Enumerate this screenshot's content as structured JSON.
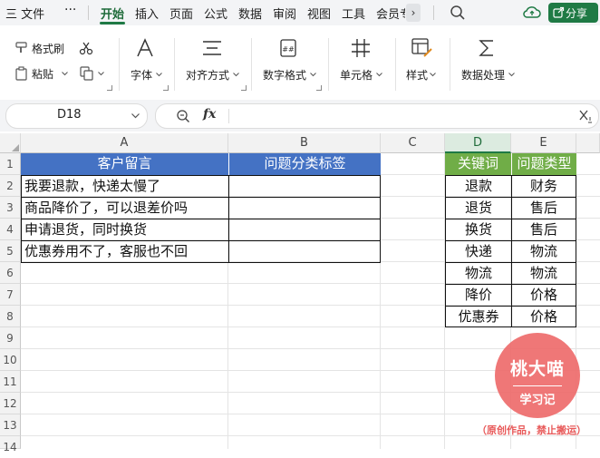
{
  "menu": {
    "app_menu": "三 文件",
    "more": "···",
    "tabs": [
      "开始",
      "插入",
      "页面",
      "公式",
      "数据",
      "审阅",
      "视图",
      "工具",
      "会员专"
    ],
    "active_tab": "开始",
    "scroll_right": "›",
    "share_label": "分享"
  },
  "ribbon": {
    "format_painter": "格式刷",
    "paste": "粘贴",
    "font": "字体",
    "align": "对齐方式",
    "number_format": "数字格式",
    "cell": "单元格",
    "style": "样式",
    "data_process": "数据处理"
  },
  "formula_bar": {
    "cell_ref": "D18",
    "fx": "fx",
    "value": ""
  },
  "sheet": {
    "columns": [
      "A",
      "B",
      "C",
      "D",
      "E"
    ],
    "selected_column": "D",
    "rows": [
      "1",
      "2",
      "3",
      "4",
      "5",
      "6",
      "7",
      "8",
      "9",
      "10",
      "11",
      "12",
      "13",
      "14"
    ],
    "A1": "客户留言",
    "B1": "问题分类标签",
    "A2": "我要退款，快递太慢了",
    "A3": "商品降价了，可以退差价吗",
    "A4": "申请退货，同时换货",
    "A5": "优惠券用不了，客服也不回",
    "D1": "关键词",
    "E1": "问题类型",
    "keywords": [
      {
        "key": "退款",
        "type": "财务"
      },
      {
        "key": "退货",
        "type": "售后"
      },
      {
        "key": "换货",
        "type": "售后"
      },
      {
        "key": "快递",
        "type": "物流"
      },
      {
        "key": "物流",
        "type": "物流"
      },
      {
        "key": "降价",
        "type": "价格"
      },
      {
        "key": "优惠券",
        "type": "价格"
      }
    ],
    "colors": {
      "header_blue": "#4472c4",
      "header_green": "#70ad47",
      "accent": "#1f7a45"
    }
  },
  "watermark": {
    "name": "桃大喵",
    "sub": "学习记",
    "note": "（原创作品，禁止搬运）"
  }
}
